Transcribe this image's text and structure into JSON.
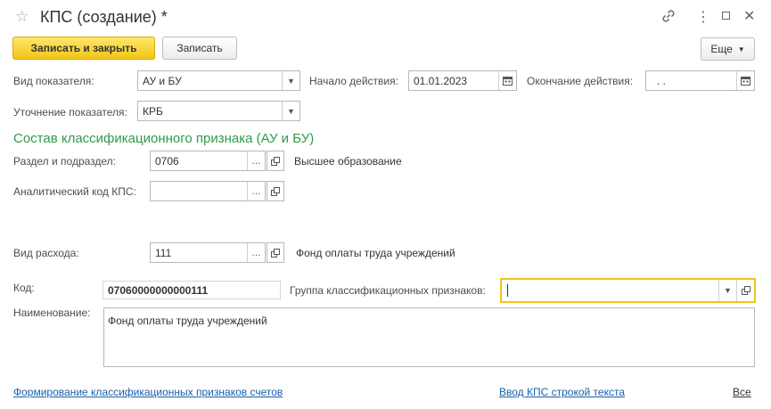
{
  "window": {
    "title": "КПС (создание) *",
    "accent_color": "#f2c618",
    "section_color": "#2e9b4b",
    "link_color": "#1a5fa8"
  },
  "toolbar": {
    "save_close_label": "Записать и закрыть",
    "save_label": "Записать",
    "more_label": "Еще"
  },
  "form": {
    "indicator_type": {
      "label": "Вид показателя:",
      "value": "АУ и БУ"
    },
    "start_date": {
      "label": "Начало действия:",
      "value": "01.01.2023"
    },
    "end_date": {
      "label": "Окончание действия:",
      "value": " .  ."
    },
    "indicator_refinement": {
      "label": "Уточнение показателя:",
      "value": "КРБ"
    },
    "section_title": "Состав классификационного признака (АУ и БУ)",
    "division": {
      "label": "Раздел и подраздел:",
      "value": "0706",
      "description": "Высшее образование"
    },
    "analytic_code": {
      "label": "Аналитический код КПС:",
      "value": ""
    },
    "expense_type": {
      "label": "Вид расхода:",
      "value": "111",
      "description": "Фонд оплаты труда учреждений"
    },
    "code": {
      "label": "Код:",
      "value": "07060000000000111"
    },
    "group": {
      "label": "Группа классификационных признаков:",
      "value": ""
    },
    "name": {
      "label": "Наименование:",
      "value": "Фонд оплаты труда учреждений"
    }
  },
  "footer": {
    "link_left": "Формирование классификационных признаков счетов",
    "link_middle": "Ввод КПС строкой текста",
    "link_right": "Все"
  }
}
